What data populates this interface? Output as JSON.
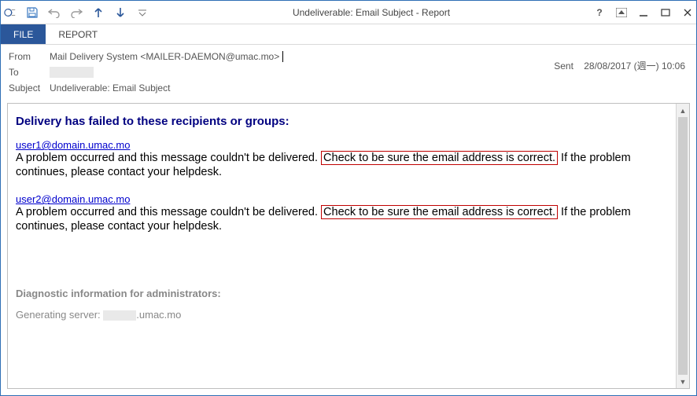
{
  "window": {
    "title": "Undeliverable: Email Subject - Report"
  },
  "ribbon": {
    "file": "FILE",
    "report": "REPORT"
  },
  "meta": {
    "from_label": "From",
    "from_value": "Mail Delivery System <MAILER-DAEMON@umac.mo>",
    "to_label": "To",
    "subject_label": "Subject",
    "subject_value": "Undeliverable: Email Subject",
    "sent_label": "Sent",
    "sent_value": "28/08/2017 (週一) 10:06"
  },
  "body": {
    "heading": "Delivery has failed to these recipients or groups:",
    "recipients": [
      {
        "email": "user1@domain.umac.mo",
        "msg_pre": "A problem occurred and this message couldn't be delivered. ",
        "msg_hl": "Check to be sure the email address is correct.",
        "msg_post": " If the problem continues, please contact your helpdesk."
      },
      {
        "email": "user2@domain.umac.mo",
        "msg_pre": "A problem occurred and this message couldn't be delivered. ",
        "msg_hl": "Check to be sure the email address is correct.",
        "msg_post": " If the problem continues, please contact your helpdesk."
      }
    ],
    "diag_head": "Diagnostic information for administrators:",
    "diag_line_pre": "Generating server: ",
    "diag_line_post": ".umac.mo"
  }
}
